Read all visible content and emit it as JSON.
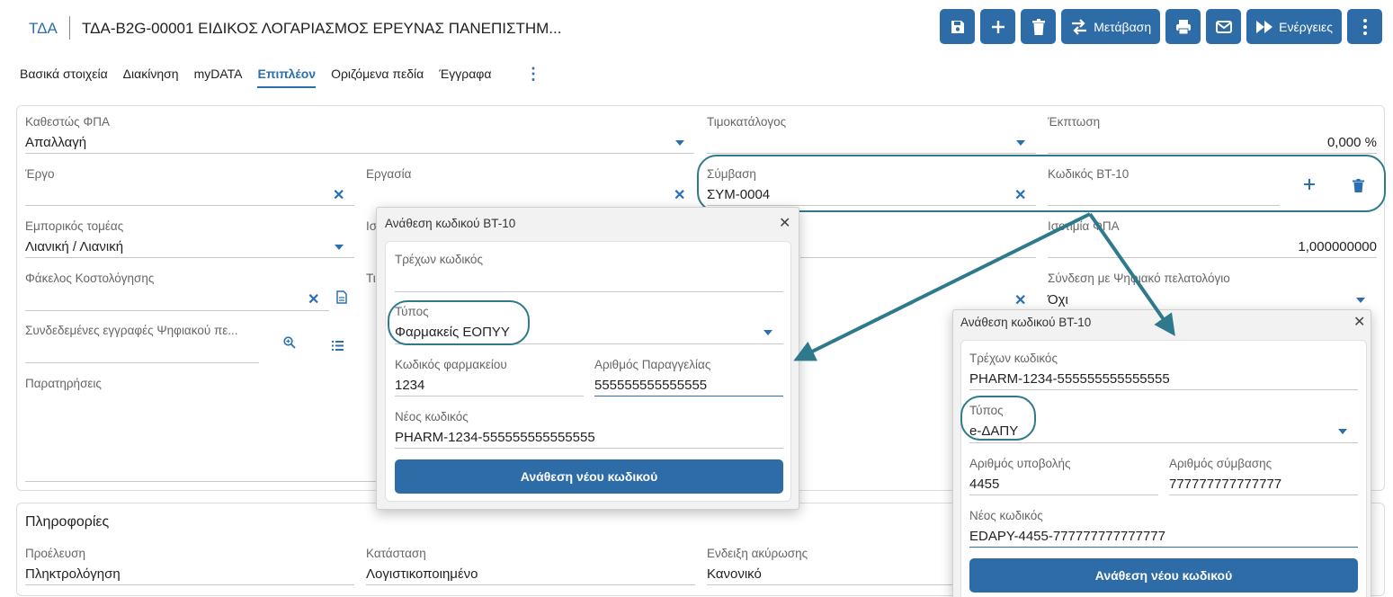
{
  "header": {
    "brand": "ΤΔΑ",
    "title": "ΤΔΑ-B2G-00001 ΕΙΔΙΚΟΣ ΛΟΓΑΡΙΑΣΜΟΣ ΕΡΕΥΝΑΣ ΠΑΝΕΠΙΣΤΗΜ...",
    "toolbar": {
      "transfer_label": "Μετάβαση",
      "actions_label": "Ενέργειες"
    }
  },
  "tabs": [
    "Βασικά στοιχεία",
    "Διακίνηση",
    "myDATA",
    "Επιπλέον",
    "Οριζόμενα πεδία",
    "Έγγραφα"
  ],
  "form": {
    "vat_status": {
      "label": "Καθεστώς ΦΠΑ",
      "value": "Απαλλαγή"
    },
    "pricelist": {
      "label": "Τιμοκατάλογος",
      "value": ""
    },
    "discount": {
      "label": "Έκπτωση",
      "value": "0,000 %"
    },
    "project": {
      "label": "Έργο",
      "value": ""
    },
    "task": {
      "label": "Εργασία",
      "value": ""
    },
    "contract": {
      "label": "Σύμβαση",
      "value": "ΣΥΜ-0004"
    },
    "bt10": {
      "label": "Κωδικός BT-10",
      "value": ""
    },
    "sector": {
      "label": "Εμπορικός τομέας",
      "value": "Λιανική / Λιανική"
    },
    "partial_label_1": "Ισ",
    "vat_eq": {
      "label": "Ισοτιμία ΦΠΑ",
      "value": "1,000000000"
    },
    "costing": {
      "label": "Φάκελος Κοστολόγησης",
      "value": ""
    },
    "partial_label_2": "Τι",
    "digital_link": {
      "label": "Σύνδεση με Ψηφιακό πελατολόγιο",
      "value": "Όχι"
    },
    "linked_records": {
      "label": "Συνδεδεμένες εγγραφές Ψηφιακού πε...",
      "value": ""
    },
    "notes": {
      "label": "Παρατηρήσεις",
      "value": ""
    }
  },
  "info": {
    "title": "Πληροφορίες",
    "origin": {
      "label": "Προέλευση",
      "value": "Πληκτρολόγηση"
    },
    "state": {
      "label": "Κατάσταση",
      "value": "Λογιστικοποιημένο"
    },
    "cancel": {
      "label": "Ενδειξη ακύρωσης",
      "value": "Κανονικό"
    }
  },
  "dialog1": {
    "title": "Ανάθεση κωδικού BT-10",
    "current_label": "Τρέχων κωδικός",
    "current_value": "",
    "type_label": "Τύπος",
    "type_value": "Φαρμακείς ΕΟΠΥΥ",
    "f1_label": "Κωδικός φαρμακείου",
    "f1_value": "1234",
    "f2_label": "Αριθμός Παραγγελίας",
    "f2_value": "555555555555555",
    "new_label": "Νέος κωδικός",
    "new_value": "PHARM-1234-555555555555555",
    "button": "Ανάθεση νέου κωδικού"
  },
  "dialog2": {
    "title": "Ανάθεση κωδικού BT-10",
    "current_label": "Τρέχων κωδικός",
    "current_value": "PHARM-1234-555555555555555",
    "type_label": "Τύπος",
    "type_value": "e-ΔΑΠΥ",
    "f1_label": "Αριθμός υποβολής",
    "f1_value": "4455",
    "f2_label": "Αριθμός σύμβασης",
    "f2_value": "777777777777777",
    "new_label": "Νέος κωδικός",
    "new_value": "EDAPY-4455-777777777777777",
    "button": "Ανάθεση νέου κωδικού"
  },
  "colors": {
    "accent": "#2e6ca8",
    "annotation": "#2e7a8c"
  }
}
